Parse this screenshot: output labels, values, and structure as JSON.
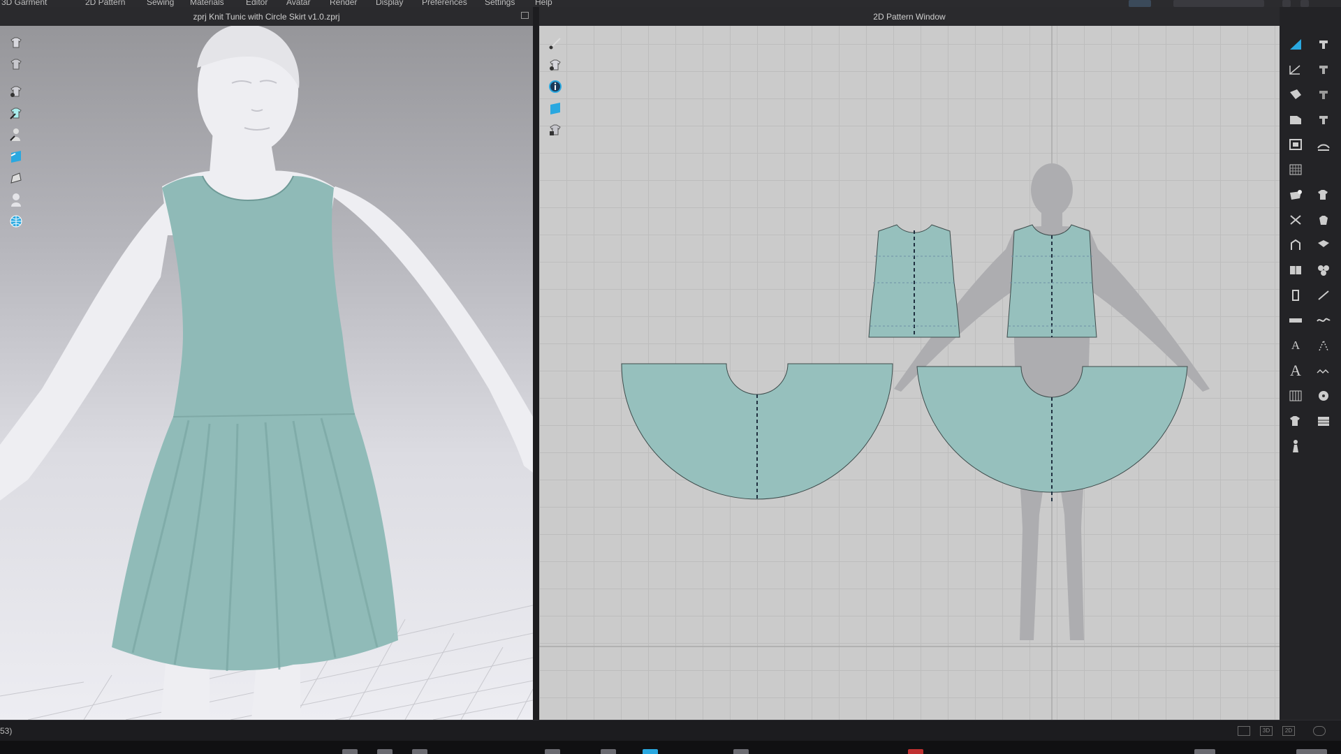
{
  "menu": {
    "items": [
      "3D Garment",
      "2D Pattern",
      "Sewing",
      "Materials",
      "Editor",
      "Avatar",
      "Render",
      "Display",
      "Preferences",
      "Settings",
      "Help"
    ]
  },
  "window3d": {
    "title": "zprj Knit Tunic with Circle Skirt v1.0.zprj"
  },
  "window2d": {
    "title": "2D Pattern Window"
  },
  "colors": {
    "fabric": "#96c0bd",
    "fabric_dark": "#7aa7a4",
    "avatar": "#f1f1f3",
    "silhouette": "#a9a9ac",
    "accent_blue": "#2aa8e0"
  },
  "status": {
    "text": "53)"
  },
  "view_buttons": [
    "",
    "3D",
    "2D",
    ""
  ]
}
